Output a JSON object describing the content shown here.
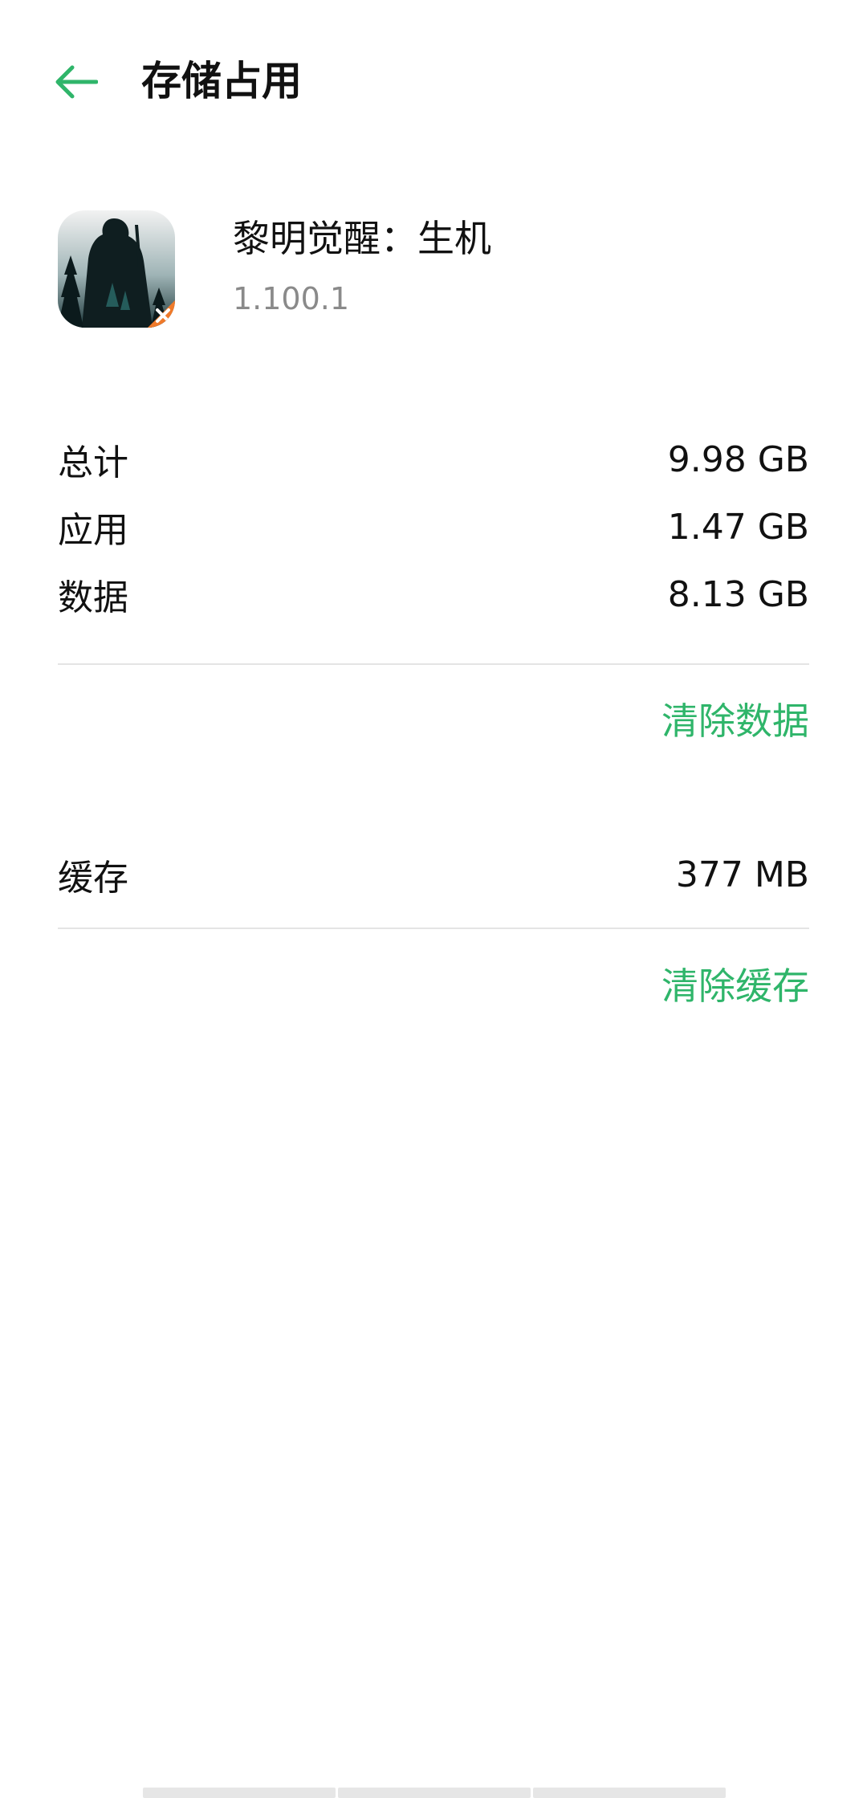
{
  "header": {
    "title": "存储占用",
    "back_icon": "arrow-left-icon",
    "accent_color": "#2fb56a"
  },
  "app": {
    "name": "黎明觉醒：生机",
    "version": "1.100.1",
    "icon": "app-icon"
  },
  "storage": {
    "rows": [
      {
        "label": "总计",
        "value": "9.98 GB"
      },
      {
        "label": "应用",
        "value": "1.47 GB"
      },
      {
        "label": "数据",
        "value": "8.13 GB"
      }
    ],
    "clear_data_label": "清除数据"
  },
  "cache": {
    "label": "缓存",
    "value": "377 MB",
    "clear_cache_label": "清除缓存"
  }
}
